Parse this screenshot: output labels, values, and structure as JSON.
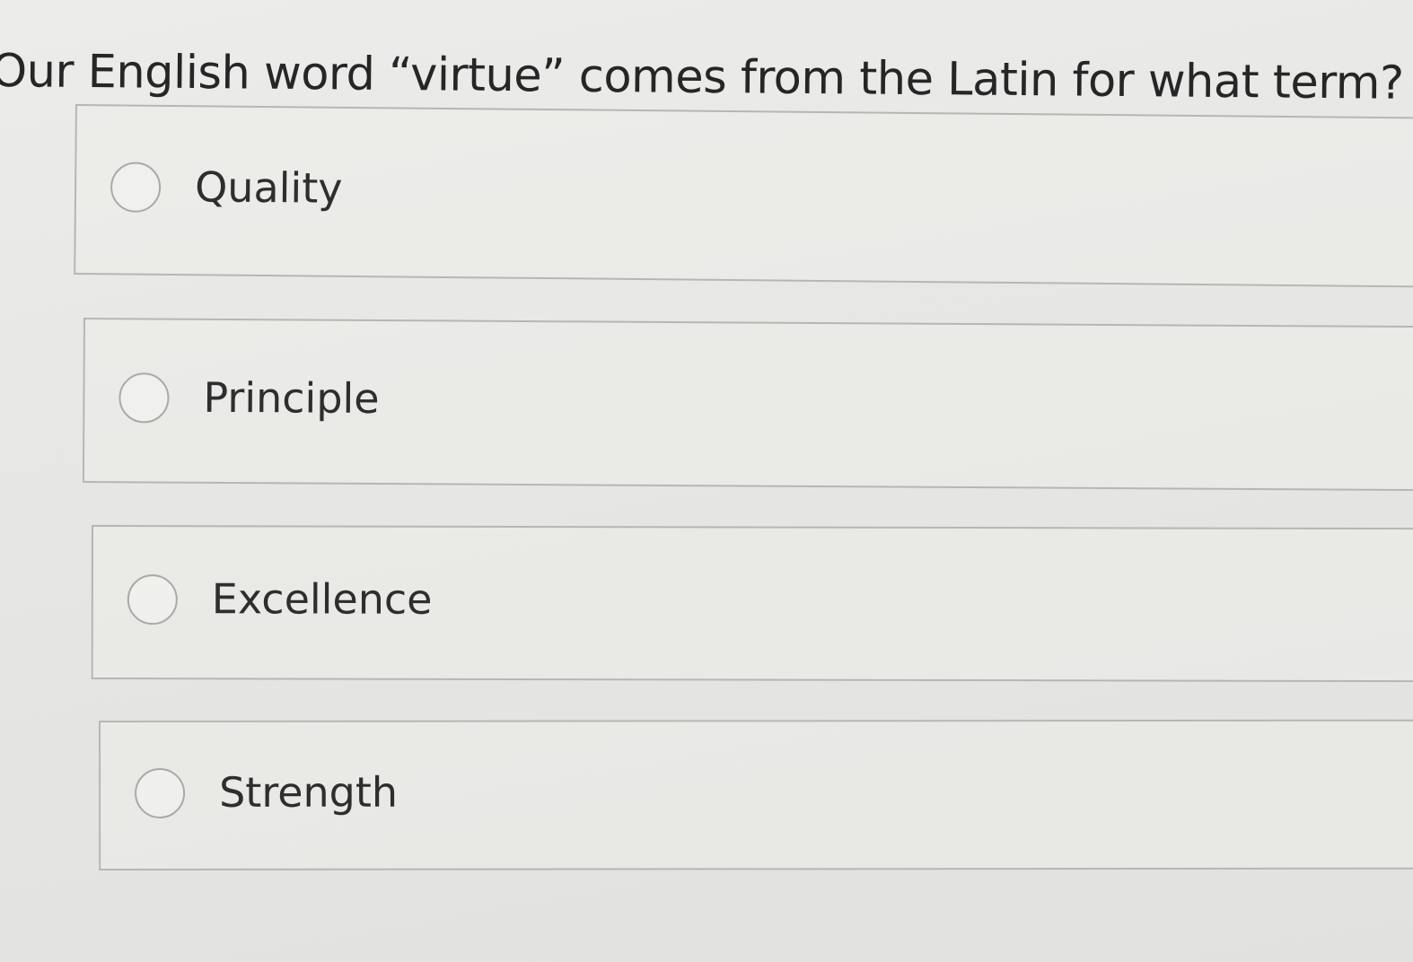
{
  "question": {
    "text": "Our English word “virtue” comes from the Latin for what term?"
  },
  "options": [
    {
      "label": "Quality"
    },
    {
      "label": "Principle"
    },
    {
      "label": "Excellence"
    },
    {
      "label": "Strength"
    }
  ],
  "colors": {
    "background": "#e6e6e4",
    "border": "#b6b6b3",
    "text": "#2c2c2c",
    "radio_border": "#a9a9a6"
  }
}
